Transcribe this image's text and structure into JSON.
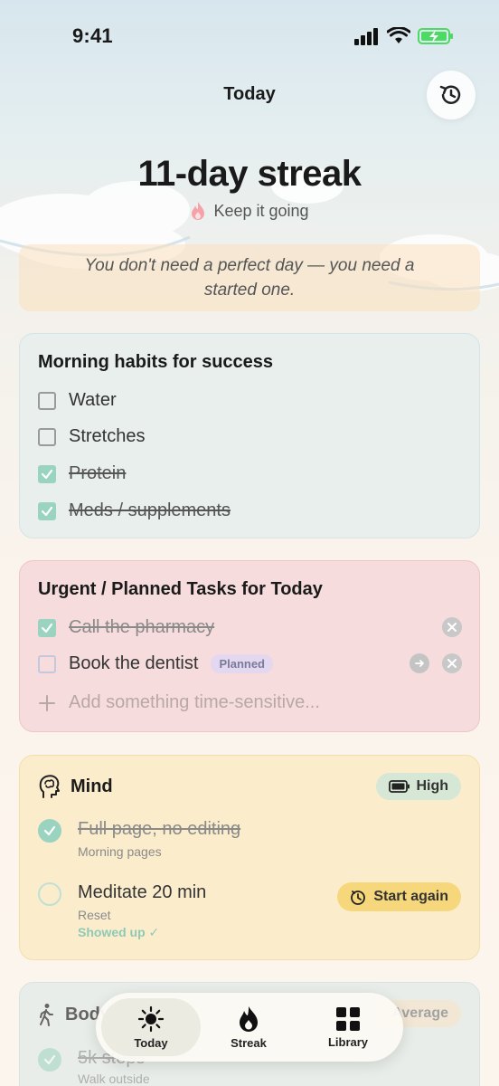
{
  "status_bar": {
    "time": "9:41"
  },
  "header": {
    "title": "Today"
  },
  "streak": {
    "title": "11-day streak",
    "subtitle": "Keep it going"
  },
  "quote": "You don't need a perfect day — you need a started one.",
  "habits": {
    "title": "Morning habits for success",
    "items": [
      {
        "label": "Water",
        "checked": false
      },
      {
        "label": "Stretches",
        "checked": false
      },
      {
        "label": "Protein",
        "checked": true
      },
      {
        "label": "Meds / supplements",
        "checked": true
      }
    ]
  },
  "urgent": {
    "title": "Urgent / Planned Tasks for Today",
    "items": [
      {
        "label": "Call the pharmacy",
        "checked": true
      },
      {
        "label": "Book the dentist",
        "checked": false,
        "badge": "Planned"
      }
    ],
    "add_placeholder": "Add something time-sensitive..."
  },
  "mind": {
    "title": "Mind",
    "energy": "High",
    "tasks": [
      {
        "title": "Full page, no editing",
        "subtitle": "Morning pages",
        "done": true
      },
      {
        "title": "Meditate 20 min",
        "subtitle": "Reset",
        "note": "Showed up ✓",
        "done": false,
        "action": "Start again"
      }
    ]
  },
  "body_card": {
    "title": "Body",
    "energy": "Average",
    "tasks": [
      {
        "title": "5k steps",
        "subtitle": "Walk outside",
        "done": true
      }
    ]
  },
  "tabbar": {
    "tabs": [
      {
        "label": "Today",
        "icon": "sun-icon",
        "active": true
      },
      {
        "label": "Streak",
        "icon": "flame-icon",
        "active": false
      },
      {
        "label": "Library",
        "icon": "grid-icon",
        "active": false
      }
    ]
  },
  "colors": {
    "accent_green": "#9ad3c0",
    "habits_bg": "#e8efed",
    "urgent_bg": "#f6dcdc",
    "mind_bg": "#fbedcc",
    "start_btn": "#f7d77b"
  }
}
